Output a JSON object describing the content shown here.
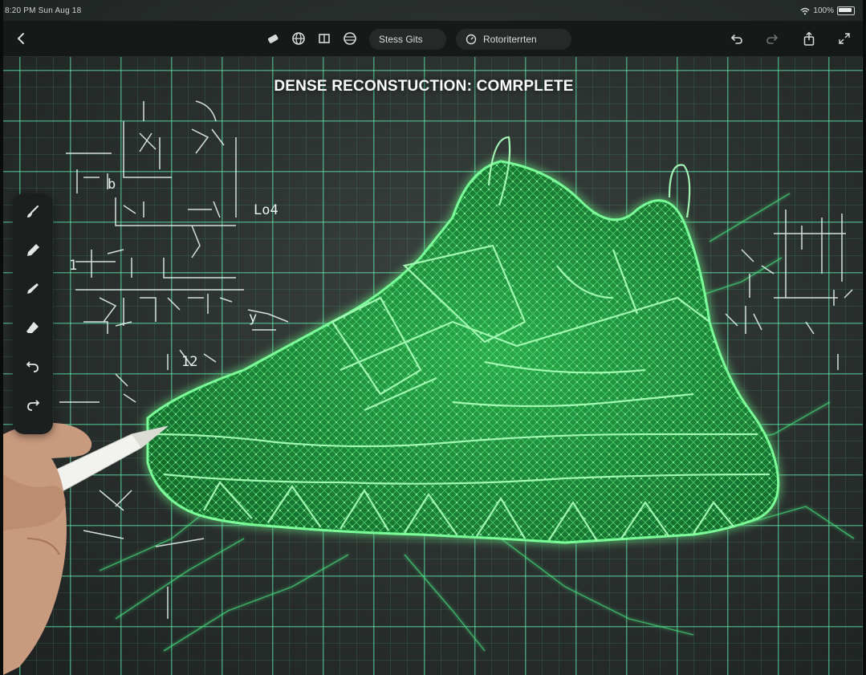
{
  "status_bar": {
    "time_date": "8:20 PM   Sun Aug 18",
    "battery_text": "100%",
    "wifi_icon": "wifi-icon",
    "battery_icon": "battery-icon"
  },
  "toolbar": {
    "back_icon": "chevron-left-icon",
    "tools": [
      "marker-icon",
      "globe-icon",
      "layers-icon",
      "grid-icon"
    ],
    "pill_1_label": "Stess Gits",
    "pill_2_label": "Rotoriterrten",
    "undo_icon": "undo-icon",
    "redo_icon": "redo-icon",
    "share_icon": "share-icon",
    "expand_icon": "expand-icon"
  },
  "canvas": {
    "title": "DENSE RECONSTUCTION: COMRPLETE",
    "annotations": {
      "label_a": "Lo4",
      "label_b": "12",
      "label_c": "b",
      "label_d": "1",
      "label_e": "y"
    },
    "colors": {
      "accent_green": "#39e86a",
      "grid_green": "#5ce6aa",
      "mesh_fill": "#1f8a3c"
    }
  },
  "palette": {
    "tools": [
      "brush-icon",
      "pen-icon",
      "pencil-icon",
      "eraser-icon",
      "lasso-undo-icon",
      "redo-arrow-icon"
    ]
  }
}
